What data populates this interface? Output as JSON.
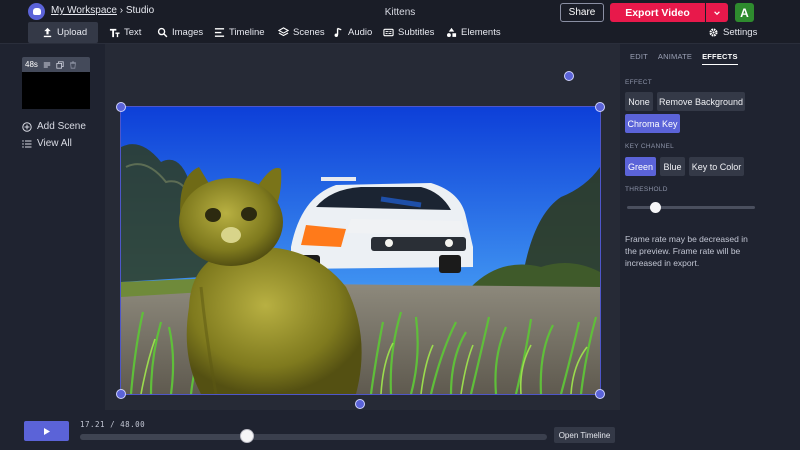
{
  "header": {
    "breadcrumb_workspace": "My Workspace",
    "breadcrumb_separator": "›",
    "breadcrumb_current": "Studio",
    "project_title": "Kittens",
    "share_label": "Share",
    "export_label": "Export Video",
    "avatar_initial": "A",
    "brand_color": "#e8194b",
    "accent_color": "#5b63d8"
  },
  "toolbar": {
    "items": [
      {
        "label": "Upload",
        "icon": "upload-icon",
        "active": true
      },
      {
        "label": "Text",
        "icon": "text-icon"
      },
      {
        "label": "Images",
        "icon": "search-icon"
      },
      {
        "label": "Timeline",
        "icon": "timeline-icon"
      },
      {
        "label": "Scenes",
        "icon": "layers-icon"
      },
      {
        "label": "Audio",
        "icon": "music-note-icon"
      },
      {
        "label": "Subtitles",
        "icon": "subtitles-icon"
      },
      {
        "label": "Elements",
        "icon": "shapes-icon"
      }
    ],
    "settings_label": "Settings"
  },
  "scenes": {
    "duration": "48s",
    "add_scene_label": "Add Scene",
    "view_all_label": "View All"
  },
  "panel": {
    "tabs": [
      "EDIT",
      "ANIMATE",
      "EFFECTS"
    ],
    "selected_tab": "EFFECTS",
    "effect_section": "EFFECT",
    "effects": [
      "None",
      "Remove Background",
      "Chroma Key"
    ],
    "selected_effect": "Chroma Key",
    "key_channel_section": "KEY CHANNEL",
    "key_channels": [
      "Green",
      "Blue",
      "Key to Color"
    ],
    "selected_channel": "Green",
    "threshold_section": "THRESHOLD",
    "threshold_value": 0.22,
    "note": "Frame rate may be decreased in the preview. Frame rate will be increased in export."
  },
  "playback": {
    "current_time": "17.21",
    "separator": "/",
    "total_time": "48.00",
    "progress": 0.3585,
    "open_timeline_label": "Open Timeline"
  }
}
